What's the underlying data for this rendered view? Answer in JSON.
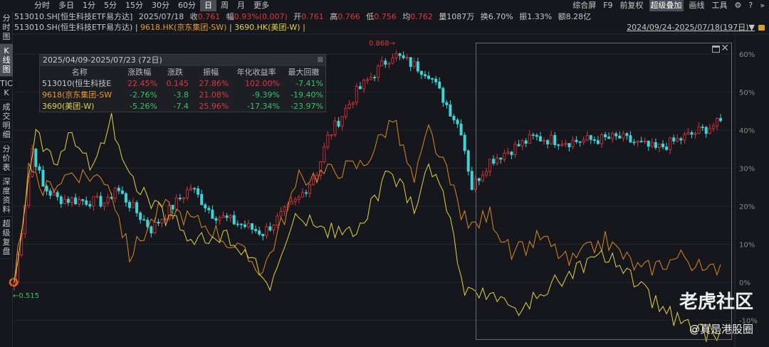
{
  "topbar": {
    "tabs": [
      "分时",
      "多日",
      "1分",
      "5分",
      "15分",
      "30分",
      "60分",
      "日",
      "周",
      "月",
      "更多"
    ],
    "active": 7,
    "tools": [
      "综合屏",
      "F9",
      "前复权",
      "超级叠加",
      "画线",
      "工具"
    ],
    "tools_active": 3
  },
  "info": {
    "name": "513010.SH[恒生科技ETF易方达]",
    "date": "2025/07/18",
    "close_label": "收",
    "close": "0.761",
    "chg_label": "幅",
    "chg": "0.93%(0.007)",
    "open_label": "开",
    "open": "0.761",
    "high_label": "高",
    "high": "0.766",
    "low_label": "低",
    "low": "0.756",
    "avg_label": "均",
    "avg": "0.762",
    "vol_label": "量",
    "vol": "1087万",
    "turn_label": "换",
    "turn": "6.70%",
    "amp_label": "振",
    "amp": "1.33%",
    "amt_label": "额",
    "amt": "8.28亿"
  },
  "compare": {
    "main": "513010.SH(恒生科技ETF易方达)",
    "s1": "9618.HK(京东集团-SW)",
    "s2": "3690.HK(美团-W)",
    "sep": "|"
  },
  "range": "2024/09/24-2025/07/18(197日)▼",
  "sidebar": [
    "分时图",
    "K线图",
    "TICK",
    "成交明细",
    "分价表",
    "深度资料",
    "超级复盘"
  ],
  "sidebar_active": 1,
  "stats": {
    "title": "2025/04/09-2025/07/23 (72日)",
    "headers": [
      "名称",
      "涨跌幅",
      "涨跌",
      "振幅",
      "年化收益率",
      "最大回撤"
    ],
    "rows": [
      [
        "513010(恒生科技E",
        "22.45%",
        "0.145",
        "27.86%",
        "102.00%",
        "-7.41%"
      ],
      [
        "9618(京东集团-SW",
        "-2.76%",
        "-3.8",
        "21.08%",
        "-9.39%",
        "-19.40%"
      ],
      [
        "3690(美团-W)",
        "-5.26%",
        "-7.4",
        "25.96%",
        "-17.34%",
        "-23.97%"
      ]
    ]
  },
  "annotations": {
    "high": "0.868→",
    "low": "←0.515"
  },
  "watermark": {
    "brand": "老虎社区",
    "author": "@真是港股圈"
  },
  "chart_data": {
    "type": "line",
    "days": 197,
    "y_ticks": [
      "60%",
      "50%",
      "40%",
      "30%",
      "20%",
      "10%",
      "0%",
      "-10%"
    ],
    "y_values": [
      60,
      50,
      40,
      30,
      20,
      10,
      0,
      -10
    ],
    "series": [
      {
        "name": "513010.SH",
        "kind": "candle",
        "color": "#e0353e",
        "down_color": "#3fd3d6",
        "points": [
          [
            0,
            0
          ],
          [
            5,
            35
          ],
          [
            8,
            25
          ],
          [
            12,
            22
          ],
          [
            26,
            21
          ],
          [
            28,
            25
          ],
          [
            38,
            14
          ],
          [
            49,
            25
          ],
          [
            55,
            18
          ],
          [
            69,
            13
          ],
          [
            79,
            22
          ],
          [
            84,
            29
          ],
          [
            87,
            38
          ],
          [
            95,
            50
          ],
          [
            105,
            60
          ],
          [
            115,
            55
          ],
          [
            121,
            45
          ],
          [
            124,
            40
          ],
          [
            127,
            25
          ],
          [
            132,
            32
          ],
          [
            144,
            38
          ],
          [
            154,
            37
          ],
          [
            168,
            38
          ],
          [
            178,
            35
          ],
          [
            196,
            42
          ]
        ]
      },
      {
        "name": "9618.HK",
        "kind": "line",
        "color": "#d98a22",
        "points": [
          [
            0,
            0
          ],
          [
            4,
            29
          ],
          [
            8,
            24
          ],
          [
            16,
            29
          ],
          [
            26,
            27
          ],
          [
            32,
            7
          ],
          [
            41,
            20
          ],
          [
            55,
            14
          ],
          [
            69,
            3
          ],
          [
            79,
            27
          ],
          [
            87,
            29
          ],
          [
            97,
            31
          ],
          [
            105,
            43
          ],
          [
            111,
            26
          ],
          [
            115,
            40
          ],
          [
            121,
            26
          ],
          [
            126,
            14
          ],
          [
            132,
            18
          ],
          [
            138,
            7
          ],
          [
            146,
            12
          ],
          [
            154,
            5
          ],
          [
            164,
            11
          ],
          [
            174,
            3
          ],
          [
            186,
            7
          ],
          [
            192,
            2
          ],
          [
            196,
            5
          ]
        ]
      },
      {
        "name": "3690.HK",
        "kind": "line",
        "color": "#e3d340",
        "points": [
          [
            0,
            0
          ],
          [
            6,
            39
          ],
          [
            12,
            31
          ],
          [
            16,
            39
          ],
          [
            22,
            29
          ],
          [
            27,
            43
          ],
          [
            32,
            27
          ],
          [
            41,
            18
          ],
          [
            51,
            11
          ],
          [
            61,
            12
          ],
          [
            71,
            -1
          ],
          [
            79,
            18
          ],
          [
            87,
            14
          ],
          [
            95,
            12
          ],
          [
            104,
            29
          ],
          [
            111,
            20
          ],
          [
            115,
            31
          ],
          [
            121,
            18
          ],
          [
            125,
            -4
          ],
          [
            132,
            -2
          ],
          [
            140,
            -8
          ],
          [
            154,
            3
          ],
          [
            166,
            7
          ],
          [
            174,
            -2
          ],
          [
            186,
            -12
          ],
          [
            196,
            -14
          ]
        ]
      }
    ]
  }
}
